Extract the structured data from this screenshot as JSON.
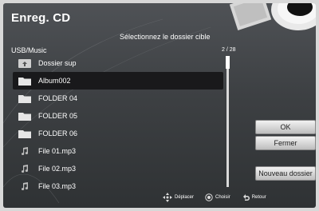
{
  "title": "Enreg. CD",
  "instruction": "Sélectionnez le dossier cible",
  "path": "USB/Music",
  "page_indicator": "2 / 28",
  "list": {
    "selected_index": 1,
    "items": [
      {
        "label": "Dossier sup",
        "icon": "parent-folder-icon"
      },
      {
        "label": "Album002",
        "icon": "folder-icon"
      },
      {
        "label": "FOLDER 04",
        "icon": "folder-icon"
      },
      {
        "label": "FOLDER 05",
        "icon": "folder-icon"
      },
      {
        "label": "FOLDER 06",
        "icon": "folder-icon"
      },
      {
        "label": "File 01.mp3",
        "icon": "music-note-icon"
      },
      {
        "label": "File 02.mp3",
        "icon": "music-note-icon"
      },
      {
        "label": "File 03.mp3",
        "icon": "music-note-icon"
      }
    ]
  },
  "buttons": {
    "ok": "OK",
    "close": "Fermer",
    "new_folder": "Nouveau dossier"
  },
  "guide": {
    "move": "Déplacer",
    "choose": "Choisir",
    "back": "Retour"
  }
}
